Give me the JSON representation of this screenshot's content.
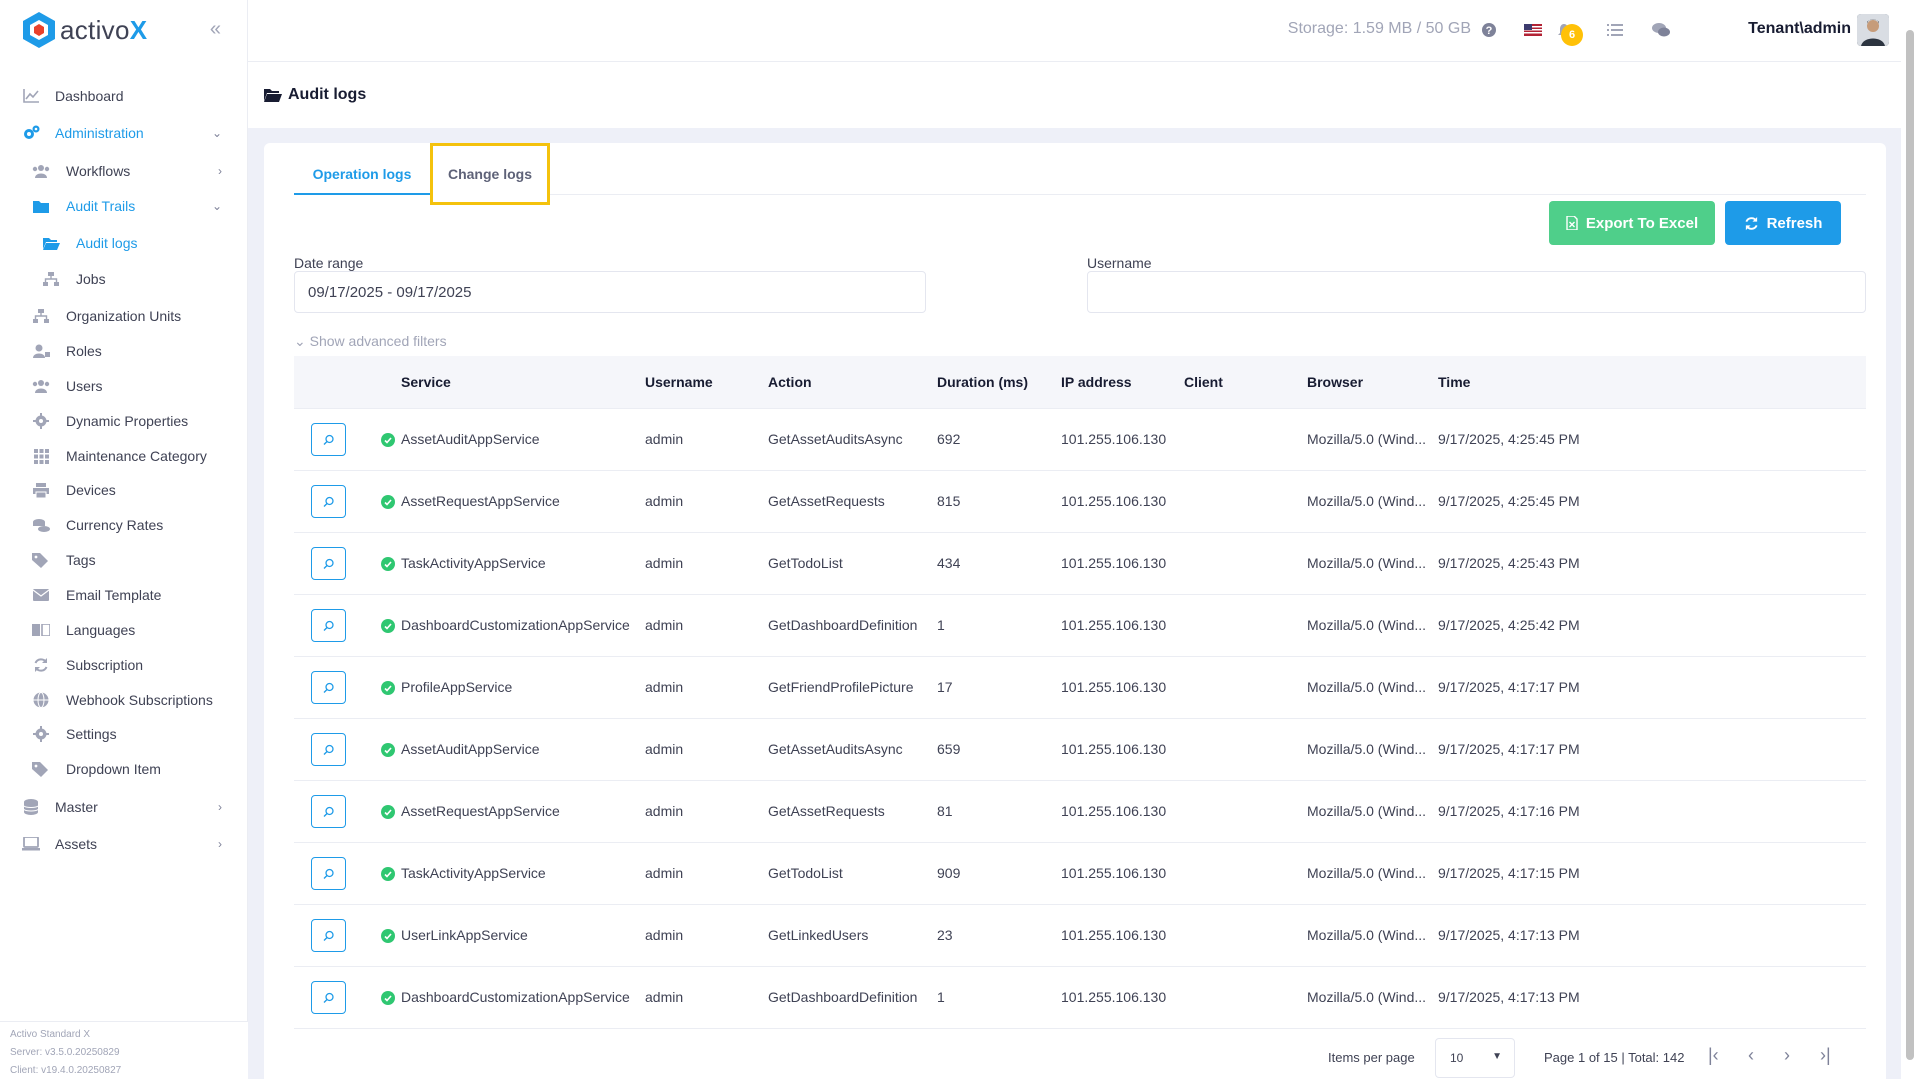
{
  "brand": {
    "name_prefix": "activo",
    "name_suffix": "X",
    "collapse_glyph": "«"
  },
  "sidebar": {
    "items": [
      {
        "label": "Dashboard",
        "icon": "chart-line-icon",
        "level": 0
      },
      {
        "label": "Administration",
        "icon": "cogs-icon",
        "level": 0,
        "active": true,
        "chevron": "⌄"
      },
      {
        "label": "Workflows",
        "icon": "users-icon",
        "level": 1,
        "chevron": "›"
      },
      {
        "label": "Audit Trails",
        "icon": "folder-icon",
        "level": 1,
        "active": true,
        "chevron": "⌄"
      },
      {
        "label": "Audit logs",
        "icon": "folder-open-icon",
        "level": 2,
        "active": true
      },
      {
        "label": "Jobs",
        "icon": "sitemap-icon",
        "level": 2
      },
      {
        "label": "Organization Units",
        "icon": "sitemap-icon",
        "level": 1
      },
      {
        "label": "Roles",
        "icon": "user-tag-icon",
        "level": 1
      },
      {
        "label": "Users",
        "icon": "users-icon",
        "level": 1
      },
      {
        "label": "Dynamic Properties",
        "icon": "gear-icon",
        "level": 1
      },
      {
        "label": "Maintenance Category",
        "icon": "grid-icon",
        "level": 1
      },
      {
        "label": "Devices",
        "icon": "printer-icon",
        "level": 1
      },
      {
        "label": "Currency Rates",
        "icon": "coins-icon",
        "level": 1
      },
      {
        "label": "Tags",
        "icon": "tags-icon",
        "level": 1
      },
      {
        "label": "Email Template",
        "icon": "envelope-icon",
        "level": 1
      },
      {
        "label": "Languages",
        "icon": "language-icon",
        "level": 1
      },
      {
        "label": "Subscription",
        "icon": "sync-icon",
        "level": 1
      },
      {
        "label": "Webhook Subscriptions",
        "icon": "globe-icon",
        "level": 1
      },
      {
        "label": "Settings",
        "icon": "gear-icon",
        "level": 1
      },
      {
        "label": "Dropdown Item",
        "icon": "tags-icon",
        "level": 1
      },
      {
        "label": "Master",
        "icon": "database-icon",
        "level": 0,
        "chevron": "›"
      },
      {
        "label": "Assets",
        "icon": "laptop-icon",
        "level": 0,
        "chevron": "›"
      }
    ],
    "footer": {
      "product": "Activo Standard X",
      "server": "Server: v3.5.0.20250829",
      "client": "Client: v19.4.0.20250827"
    }
  },
  "header": {
    "storage": "Storage: 1.59 MB / 50 GB",
    "notification_count": "6",
    "user": "Tenant\\admin"
  },
  "page": {
    "title": "Audit logs"
  },
  "tabs": {
    "operation": "Operation logs",
    "change": "Change logs"
  },
  "buttons": {
    "export": "Export To Excel",
    "refresh": "Refresh"
  },
  "filters": {
    "date_label": "Date range",
    "date_value": "09/17/2025 - 09/17/2025",
    "username_label": "Username",
    "username_value": "",
    "advanced": "Show advanced filters"
  },
  "table": {
    "columns": [
      "Service",
      "Username",
      "Action",
      "Duration (ms)",
      "IP address",
      "Client",
      "Browser",
      "Time"
    ],
    "rows": [
      {
        "service": "AssetAuditAppService",
        "username": "admin",
        "action": "GetAssetAuditsAsync",
        "duration": "692",
        "ip": "101.255.106.130",
        "client": "",
        "browser": "Mozilla/5.0 (Wind...",
        "time": "9/17/2025, 4:25:45 PM"
      },
      {
        "service": "AssetRequestAppService",
        "username": "admin",
        "action": "GetAssetRequests",
        "duration": "815",
        "ip": "101.255.106.130",
        "client": "",
        "browser": "Mozilla/5.0 (Wind...",
        "time": "9/17/2025, 4:25:45 PM"
      },
      {
        "service": "TaskActivityAppService",
        "username": "admin",
        "action": "GetTodoList",
        "duration": "434",
        "ip": "101.255.106.130",
        "client": "",
        "browser": "Mozilla/5.0 (Wind...",
        "time": "9/17/2025, 4:25:43 PM"
      },
      {
        "service": "DashboardCustomizationAppService",
        "username": "admin",
        "action": "GetDashboardDefinition",
        "duration": "1",
        "ip": "101.255.106.130",
        "client": "",
        "browser": "Mozilla/5.0 (Wind...",
        "time": "9/17/2025, 4:25:42 PM"
      },
      {
        "service": "ProfileAppService",
        "username": "admin",
        "action": "GetFriendProfilePicture",
        "duration": "17",
        "ip": "101.255.106.130",
        "client": "",
        "browser": "Mozilla/5.0 (Wind...",
        "time": "9/17/2025, 4:17:17 PM"
      },
      {
        "service": "AssetAuditAppService",
        "username": "admin",
        "action": "GetAssetAuditsAsync",
        "duration": "659",
        "ip": "101.255.106.130",
        "client": "",
        "browser": "Mozilla/5.0 (Wind...",
        "time": "9/17/2025, 4:17:17 PM"
      },
      {
        "service": "AssetRequestAppService",
        "username": "admin",
        "action": "GetAssetRequests",
        "duration": "81",
        "ip": "101.255.106.130",
        "client": "",
        "browser": "Mozilla/5.0 (Wind...",
        "time": "9/17/2025, 4:17:16 PM"
      },
      {
        "service": "TaskActivityAppService",
        "username": "admin",
        "action": "GetTodoList",
        "duration": "909",
        "ip": "101.255.106.130",
        "client": "",
        "browser": "Mozilla/5.0 (Wind...",
        "time": "9/17/2025, 4:17:15 PM"
      },
      {
        "service": "UserLinkAppService",
        "username": "admin",
        "action": "GetLinkedUsers",
        "duration": "23",
        "ip": "101.255.106.130",
        "client": "",
        "browser": "Mozilla/5.0 (Wind...",
        "time": "9/17/2025, 4:17:13 PM"
      },
      {
        "service": "DashboardCustomizationAppService",
        "username": "admin",
        "action": "GetDashboardDefinition",
        "duration": "1",
        "ip": "101.255.106.130",
        "client": "",
        "browser": "Mozilla/5.0 (Wind...",
        "time": "9/17/2025, 4:17:13 PM"
      }
    ]
  },
  "pagination": {
    "items_per_page_label": "Items per page",
    "items_per_page": "10",
    "summary": "Page 1 of 15 | Total: 142"
  },
  "colors": {
    "accent": "#1e9be8",
    "success": "#4fcf8a",
    "highlight": "#f4c20d",
    "badge": "#ffc107"
  }
}
